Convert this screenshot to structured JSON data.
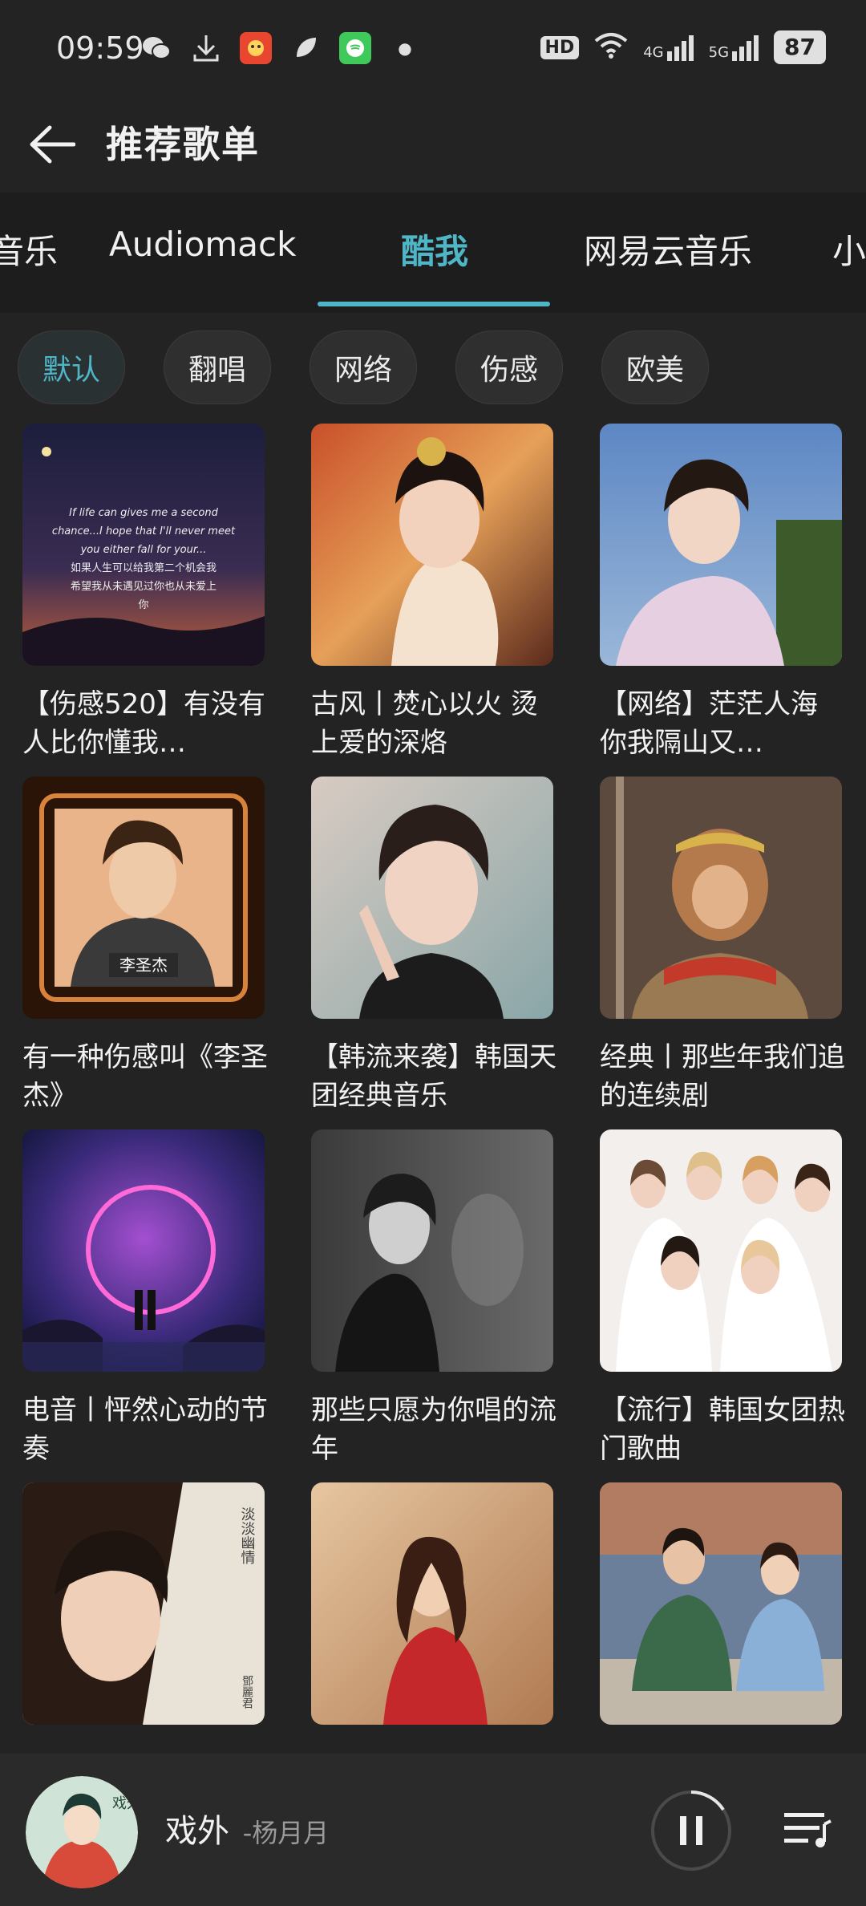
{
  "status": {
    "time": "09:59",
    "battery": "87",
    "network_labels": [
      "4G",
      "5G"
    ],
    "hd_label": "HD"
  },
  "header": {
    "title": "推荐歌单"
  },
  "tabs": [
    {
      "label": "音乐"
    },
    {
      "label": "Audiomack"
    },
    {
      "label": "酷我"
    },
    {
      "label": "网易云音乐"
    },
    {
      "label": "小"
    }
  ],
  "chips": [
    {
      "label": "默认"
    },
    {
      "label": "翻唱"
    },
    {
      "label": "网络"
    },
    {
      "label": "伤感"
    },
    {
      "label": "欧美"
    }
  ],
  "playlists": [
    {
      "title": "【伤感520】有没有人比你懂我…",
      "cover_text": [
        "If life can gives me a second",
        "chance...I hope that I'll never meet",
        "you either fall for your...",
        "如果人生可以给我第二个机会我",
        "希望我从未遇见过你也从未爱上",
        "你"
      ]
    },
    {
      "title": "古风丨焚心以火 烫上爱的深烙"
    },
    {
      "title": "【网络】茫茫人海 你我隔山又…"
    },
    {
      "title": "有一种伤感叫《李圣杰》",
      "cover_text": [
        "李圣杰"
      ]
    },
    {
      "title": "【韩流来袭】韩国天团经典音乐"
    },
    {
      "title": "经典丨那些年我们追的连续剧"
    },
    {
      "title": "电音丨怦然心动的节奏"
    },
    {
      "title": "那些只愿为你唱的流年"
    },
    {
      "title": "【流行】韩国女团热门歌曲"
    },
    {
      "title": "",
      "cover_text": [
        "淡淡幽情",
        "鄧麗君"
      ]
    },
    {
      "title": ""
    },
    {
      "title": ""
    }
  ],
  "player": {
    "song": "戏外",
    "artist": "-杨月月",
    "disc_text": "戏外"
  }
}
